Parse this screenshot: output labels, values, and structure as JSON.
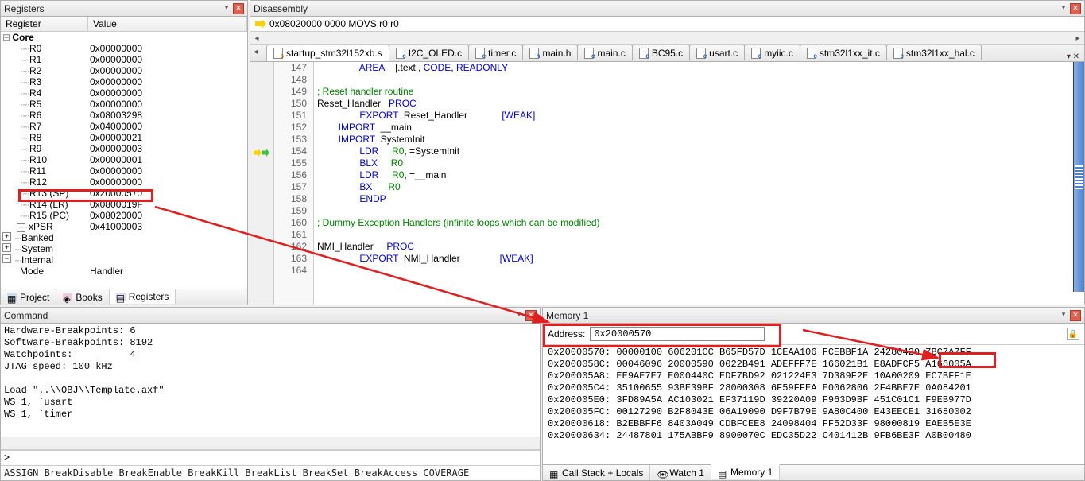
{
  "registers": {
    "title": "Registers",
    "header": {
      "name": "Register",
      "value": "Value"
    },
    "core_label": "Core",
    "rows": [
      {
        "name": "R0",
        "val": "0x00000000"
      },
      {
        "name": "R1",
        "val": "0x00000000"
      },
      {
        "name": "R2",
        "val": "0x00000000"
      },
      {
        "name": "R3",
        "val": "0x00000000"
      },
      {
        "name": "R4",
        "val": "0x00000000"
      },
      {
        "name": "R5",
        "val": "0x00000000"
      },
      {
        "name": "R6",
        "val": "0x08003298"
      },
      {
        "name": "R7",
        "val": "0x04000000"
      },
      {
        "name": "R8",
        "val": "0x00000021"
      },
      {
        "name": "R9",
        "val": "0x00000003"
      },
      {
        "name": "R10",
        "val": "0x00000001"
      },
      {
        "name": "R11",
        "val": "0x00000000"
      },
      {
        "name": "R12",
        "val": "0x00000000"
      },
      {
        "name": "R13 (SP)",
        "val": "0x20000570"
      },
      {
        "name": "R14 (LR)",
        "val": "0x0800019F"
      },
      {
        "name": "R15 (PC)",
        "val": "0x08020000"
      },
      {
        "name": "xPSR",
        "val": "0x41000003"
      }
    ],
    "groups": [
      {
        "label": "Banked"
      },
      {
        "label": "System"
      },
      {
        "label": "Internal"
      }
    ],
    "mode_row": {
      "name": "Mode",
      "val": "Handler"
    },
    "tabs": {
      "project": "Project",
      "books": "Books",
      "registers": "Registers"
    }
  },
  "disasm": {
    "title": "Disassembly",
    "line": "0x08020000 0000      MOVS     r0,r0",
    "tabs": [
      {
        "label": "startup_stm32l152xb.s",
        "kind": "s",
        "active": true
      },
      {
        "label": "I2C_OLED.c",
        "kind": "c"
      },
      {
        "label": "timer.c",
        "kind": "c"
      },
      {
        "label": "main.h",
        "kind": "h"
      },
      {
        "label": "main.c",
        "kind": "c"
      },
      {
        "label": "BC95.c",
        "kind": "c"
      },
      {
        "label": "usart.c",
        "kind": "c"
      },
      {
        "label": "myiic.c",
        "kind": "c"
      },
      {
        "label": "stm32l1xx_it.c",
        "kind": "c"
      },
      {
        "label": "stm32l1xx_hal.c",
        "kind": "c"
      }
    ],
    "first_line": 147,
    "lines": [
      "                AREA    |.text|, CODE, READONLY",
      "",
      "; Reset handler routine",
      "Reset_Handler   PROC",
      "                EXPORT  Reset_Handler             [WEAK]",
      "        IMPORT  __main",
      "        IMPORT  SystemInit",
      "                LDR     R0, =SystemInit",
      "                BLX     R0",
      "                LDR     R0, =__main",
      "                BX      R0",
      "                ENDP",
      "",
      "; Dummy Exception Handlers (infinite loops which can be modified)",
      "",
      "NMI_Handler     PROC",
      "                EXPORT  NMI_Handler               [WEAK]",
      ""
    ],
    "cursor_line": 154
  },
  "command": {
    "title": "Command",
    "lines": [
      "Hardware-Breakpoints: 6",
      "Software-Breakpoints: 8192",
      "Watchpoints:          4",
      "JTAG speed: 100 kHz",
      "",
      "Load \"..\\\\OBJ\\\\Template.axf\"",
      "WS 1, `usart",
      "WS 1, `timer"
    ],
    "input_value": ">",
    "hint": "ASSIGN BreakDisable BreakEnable BreakKill BreakList BreakSet BreakAccess COVERAGE"
  },
  "memory": {
    "title": "Memory 1",
    "addr_label": "Address:",
    "addr_value": "0x20000570",
    "rows": [
      "0x20000570: 00000100 606201CC B65FD57D 1CEAA106 FCEBBF1A 24280420 7BC7A7FF",
      "0x2000058C: 00046096 20000590 0022B491 ADEFFF7E 166021B1 E8ADFCF5 A166005A",
      "0x200005A8: EE9AE7E7 E000440C EDF7BD92 021224E3 7D389F2E 10A00209 EC7BFF1E",
      "0x200005C4: 35100655 93BE39BF 28000308 6F59FFEA E0062806 2F4BBE7E 0A084201",
      "0x200005E0: 3FD89A5A AC103021 EF37119D 39220A09 F963D9BF 451C01C1 F9EB977D",
      "0x200005FC: 00127290 B2F8043E 06A19090 D9F7B79E 9A80C400 E43EECE1 31680002",
      "0x20000618: B2EBBFF6 8403A049 CDBFCEE8 24098404 FF52D33F 98000819 EAEB5E3E",
      "0x20000634: 24487801 175ABBF9 8900070C EDC35D22 C401412B 9FB6BE3F A0B00480"
    ],
    "tabs": {
      "callstack": "Call Stack + Locals",
      "watch": "Watch 1",
      "memory": "Memory 1"
    }
  }
}
